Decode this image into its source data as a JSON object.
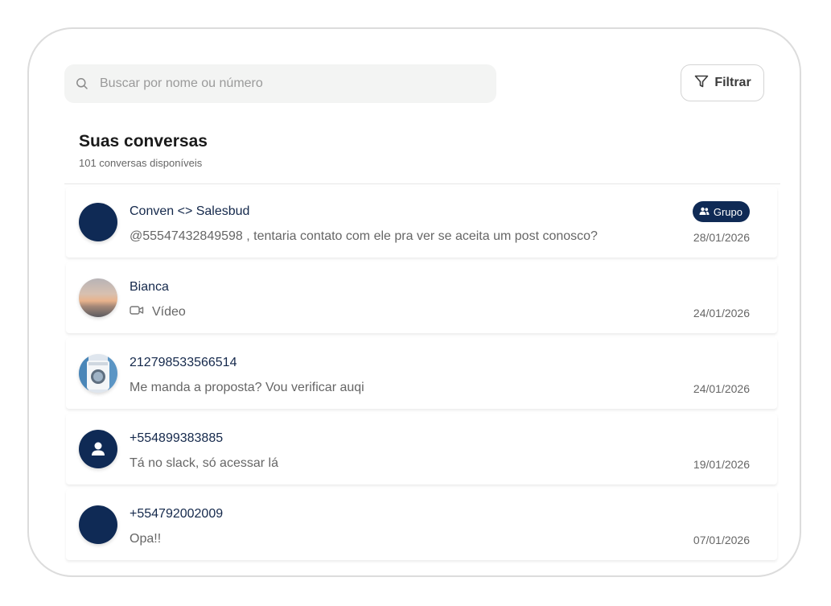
{
  "search": {
    "placeholder": "Buscar por nome ou número",
    "value": ""
  },
  "filter": {
    "label": "Filtrar"
  },
  "header": {
    "title": "Suas conversas",
    "subtitle": "101 conversas disponíveis"
  },
  "colors": {
    "navy": "#0f2a55",
    "text_muted": "#666666",
    "search_bg": "#f3f4f3"
  },
  "conversations": [
    {
      "name": "Conven <> Salesbud",
      "message": "@55547432849598 , tentaria contato com ele pra ver se aceita um post conosco?",
      "date": "28/01/2026",
      "badge": "Grupo",
      "avatar": "navy-circle"
    },
    {
      "name": "Bianca",
      "message": "Vídeo",
      "message_icon": "video-icon",
      "date": "24/01/2026",
      "avatar": "photo"
    },
    {
      "name": "212798533566514",
      "message": "Me manda a proposta? Vou verificar auqi",
      "date": "24/01/2026",
      "avatar": "photo"
    },
    {
      "name": "+554899383885",
      "message": "Tá no slack, só acessar lá",
      "date": "19/01/2026",
      "avatar": "person-icon"
    },
    {
      "name": "+554792002009",
      "message": "Opa!!",
      "date": "07/01/2026",
      "avatar": "navy-circle"
    }
  ]
}
